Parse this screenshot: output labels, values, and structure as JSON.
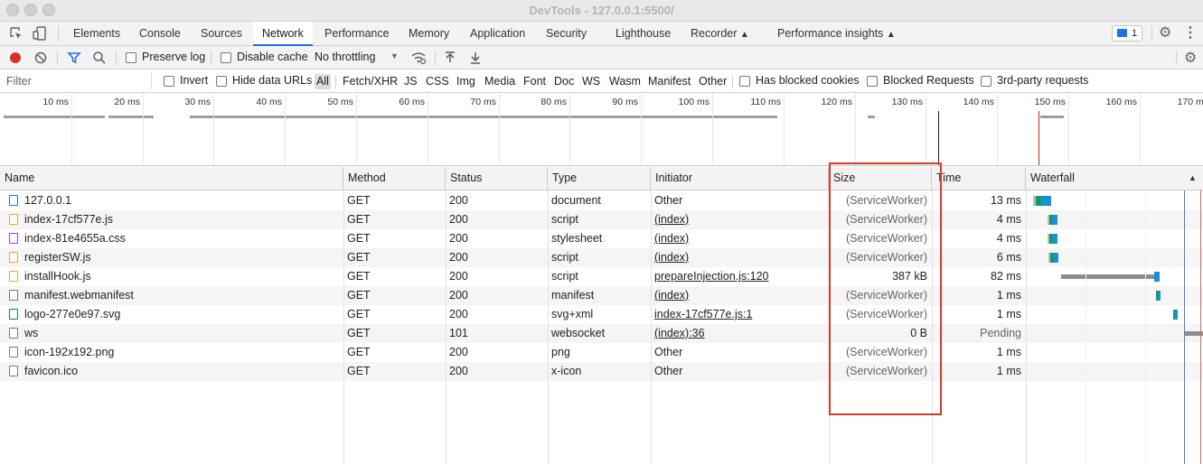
{
  "window": {
    "title": "DevTools - 127.0.0.1:5500/"
  },
  "panel_tabs": [
    {
      "label": "Elements"
    },
    {
      "label": "Console"
    },
    {
      "label": "Sources"
    },
    {
      "label": "Network"
    },
    {
      "label": "Performance"
    },
    {
      "label": "Memory"
    },
    {
      "label": "Application"
    },
    {
      "label": "Security"
    },
    {
      "label": "Lighthouse"
    },
    {
      "label": "Recorder"
    },
    {
      "label": "Performance insights"
    }
  ],
  "active_tab": "Network",
  "issues_badge": {
    "count": "1"
  },
  "toolbar": {
    "preserve_log": "Preserve log",
    "disable_cache": "Disable cache",
    "throttling": "No throttling"
  },
  "filter": {
    "placeholder": "Filter",
    "invert": "Invert",
    "hide_data_urls": "Hide data URLs",
    "types": [
      "All",
      "Fetch/XHR",
      "JS",
      "CSS",
      "Img",
      "Media",
      "Font",
      "Doc",
      "WS",
      "Wasm",
      "Manifest",
      "Other"
    ],
    "has_blocked_cookies": "Has blocked cookies",
    "blocked_requests": "Blocked Requests",
    "third_party": "3rd-party requests"
  },
  "overview": {
    "ticks": [
      "10 ms",
      "20 ms",
      "30 ms",
      "40 ms",
      "50 ms",
      "60 ms",
      "70 ms",
      "80 ms",
      "90 ms",
      "100 ms",
      "110 ms",
      "120 ms",
      "130 ms",
      "140 ms",
      "150 ms",
      "160 ms",
      "170 ms"
    ]
  },
  "columns": {
    "name": "Name",
    "method": "Method",
    "status": "Status",
    "type": "Type",
    "initiator": "Initiator",
    "size": "Size",
    "time": "Time",
    "waterfall": "Waterfall"
  },
  "requests": [
    {
      "name": "127.0.0.1",
      "icon": "document-icon",
      "method": "GET",
      "status": "200",
      "type": "document",
      "initiator": "Other",
      "size": "(ServiceWorker)",
      "time": "13 ms"
    },
    {
      "name": "index-17cf577e.js",
      "icon": "script-icon",
      "method": "GET",
      "status": "200",
      "type": "script",
      "initiator": "(index)",
      "size": "(ServiceWorker)",
      "time": "4 ms"
    },
    {
      "name": "index-81e4655a.css",
      "icon": "stylesheet-icon",
      "method": "GET",
      "status": "200",
      "type": "stylesheet",
      "initiator": "(index)",
      "size": "(ServiceWorker)",
      "time": "4 ms"
    },
    {
      "name": "registerSW.js",
      "icon": "script-icon",
      "method": "GET",
      "status": "200",
      "type": "script",
      "initiator": "(index)",
      "size": "(ServiceWorker)",
      "time": "6 ms"
    },
    {
      "name": "installHook.js",
      "icon": "script-icon",
      "method": "GET",
      "status": "200",
      "type": "script",
      "initiator": "prepareInjection.js:120",
      "size": "387 kB",
      "time": "82 ms"
    },
    {
      "name": "manifest.webmanifest",
      "icon": "file-icon",
      "method": "GET",
      "status": "200",
      "type": "manifest",
      "initiator": "(index)",
      "size": "(ServiceWorker)",
      "time": "1 ms"
    },
    {
      "name": "logo-277e0e97.svg",
      "icon": "image-icon",
      "method": "GET",
      "status": "200",
      "type": "svg+xml",
      "initiator": "index-17cf577e.js:1",
      "size": "(ServiceWorker)",
      "time": "1 ms"
    },
    {
      "name": "ws",
      "icon": "file-icon",
      "method": "GET",
      "status": "101",
      "type": "websocket",
      "initiator": "(index):36",
      "size": "0 B",
      "time": "Pending"
    },
    {
      "name": "icon-192x192.png",
      "icon": "file-icon",
      "method": "GET",
      "status": "200",
      "type": "png",
      "initiator": "Other",
      "size": "(ServiceWorker)",
      "time": "1 ms"
    },
    {
      "name": "favicon.ico",
      "icon": "file-icon",
      "method": "GET",
      "status": "200",
      "type": "x-icon",
      "initiator": "Other",
      "size": "(ServiceWorker)",
      "time": "1 ms"
    }
  ],
  "colors": {
    "accent": "#1a73e8",
    "record": "#d93025",
    "highlight": "#d93a26",
    "wf_queue": "#9e9e9e",
    "wf_wait": "#0f9d58",
    "wf_download": "#1a73e8"
  }
}
